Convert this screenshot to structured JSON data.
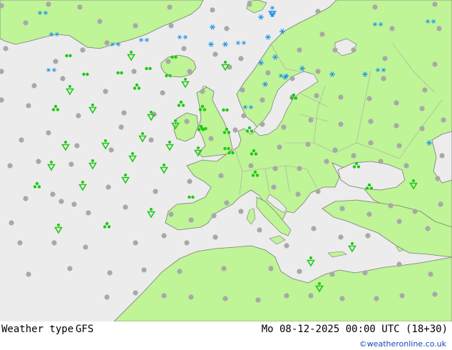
{
  "footer": {
    "title": "Weather type",
    "model": "GFS",
    "datetime": "Mo 08-12-2025 00:00 UTC (18+30)",
    "credit": "©weatheronline.co.uk"
  },
  "colors": {
    "sea": "#ececec",
    "land": "#bff497",
    "border": "#a5a5a5",
    "coast": "#7a7a7a",
    "snow": "#1e90e6",
    "rain": "#1ec814",
    "dry": "#a8a8a8"
  },
  "legend_symbols": {
    "snow": "snow-icon",
    "snow_shower": "snow-shower-icon",
    "rain_shower": "rain-shower-icon",
    "drizzle": "drizzle-icon",
    "cloudy": "cloudy-icon"
  }
}
